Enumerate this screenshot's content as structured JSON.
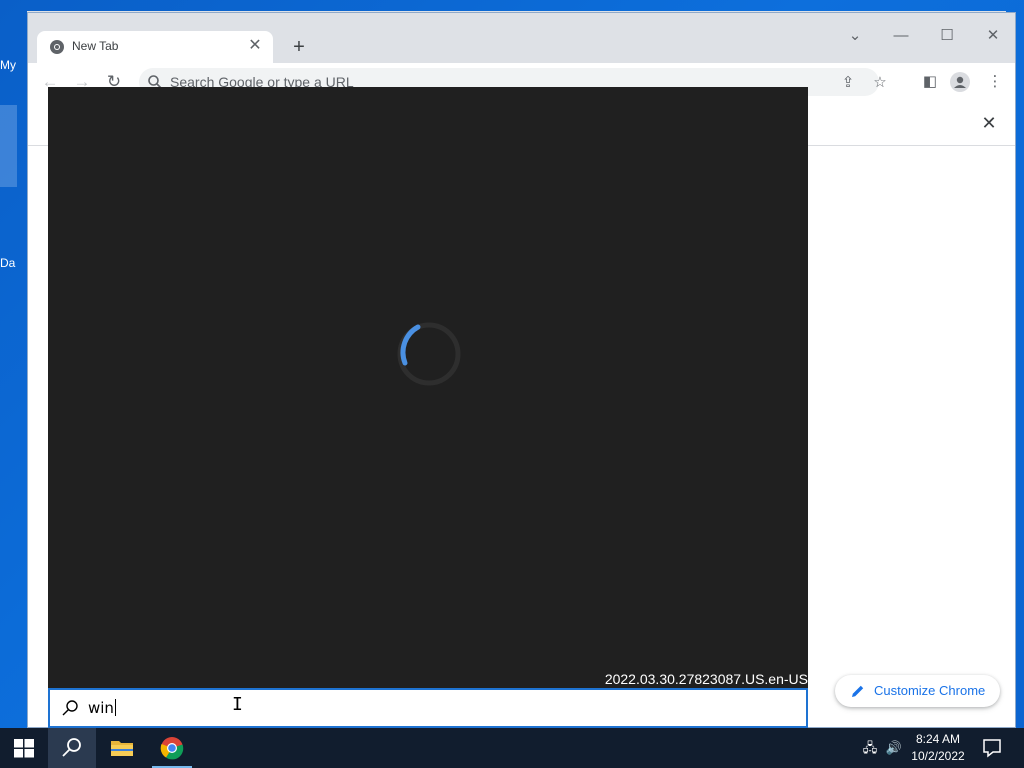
{
  "desktop": {
    "icon1_label_partial": "My",
    "icon2_label_partial": "Da"
  },
  "chrome": {
    "tab": {
      "title": "New Tab"
    },
    "omnibox": {
      "placeholder": "Search Google or type a URL"
    },
    "customize_label": "Customize Chrome"
  },
  "search_overlay": {
    "version": "2022.03.30.27823087.US.en-US",
    "query": "win"
  },
  "taskbar": {
    "time": "8:24 AM",
    "date": "10/2/2022"
  },
  "colors": {
    "accent": "#1a73e8",
    "overlay_bg": "#202020",
    "taskbar_bg": "#111d2e",
    "spinner": "#4a90e2"
  }
}
